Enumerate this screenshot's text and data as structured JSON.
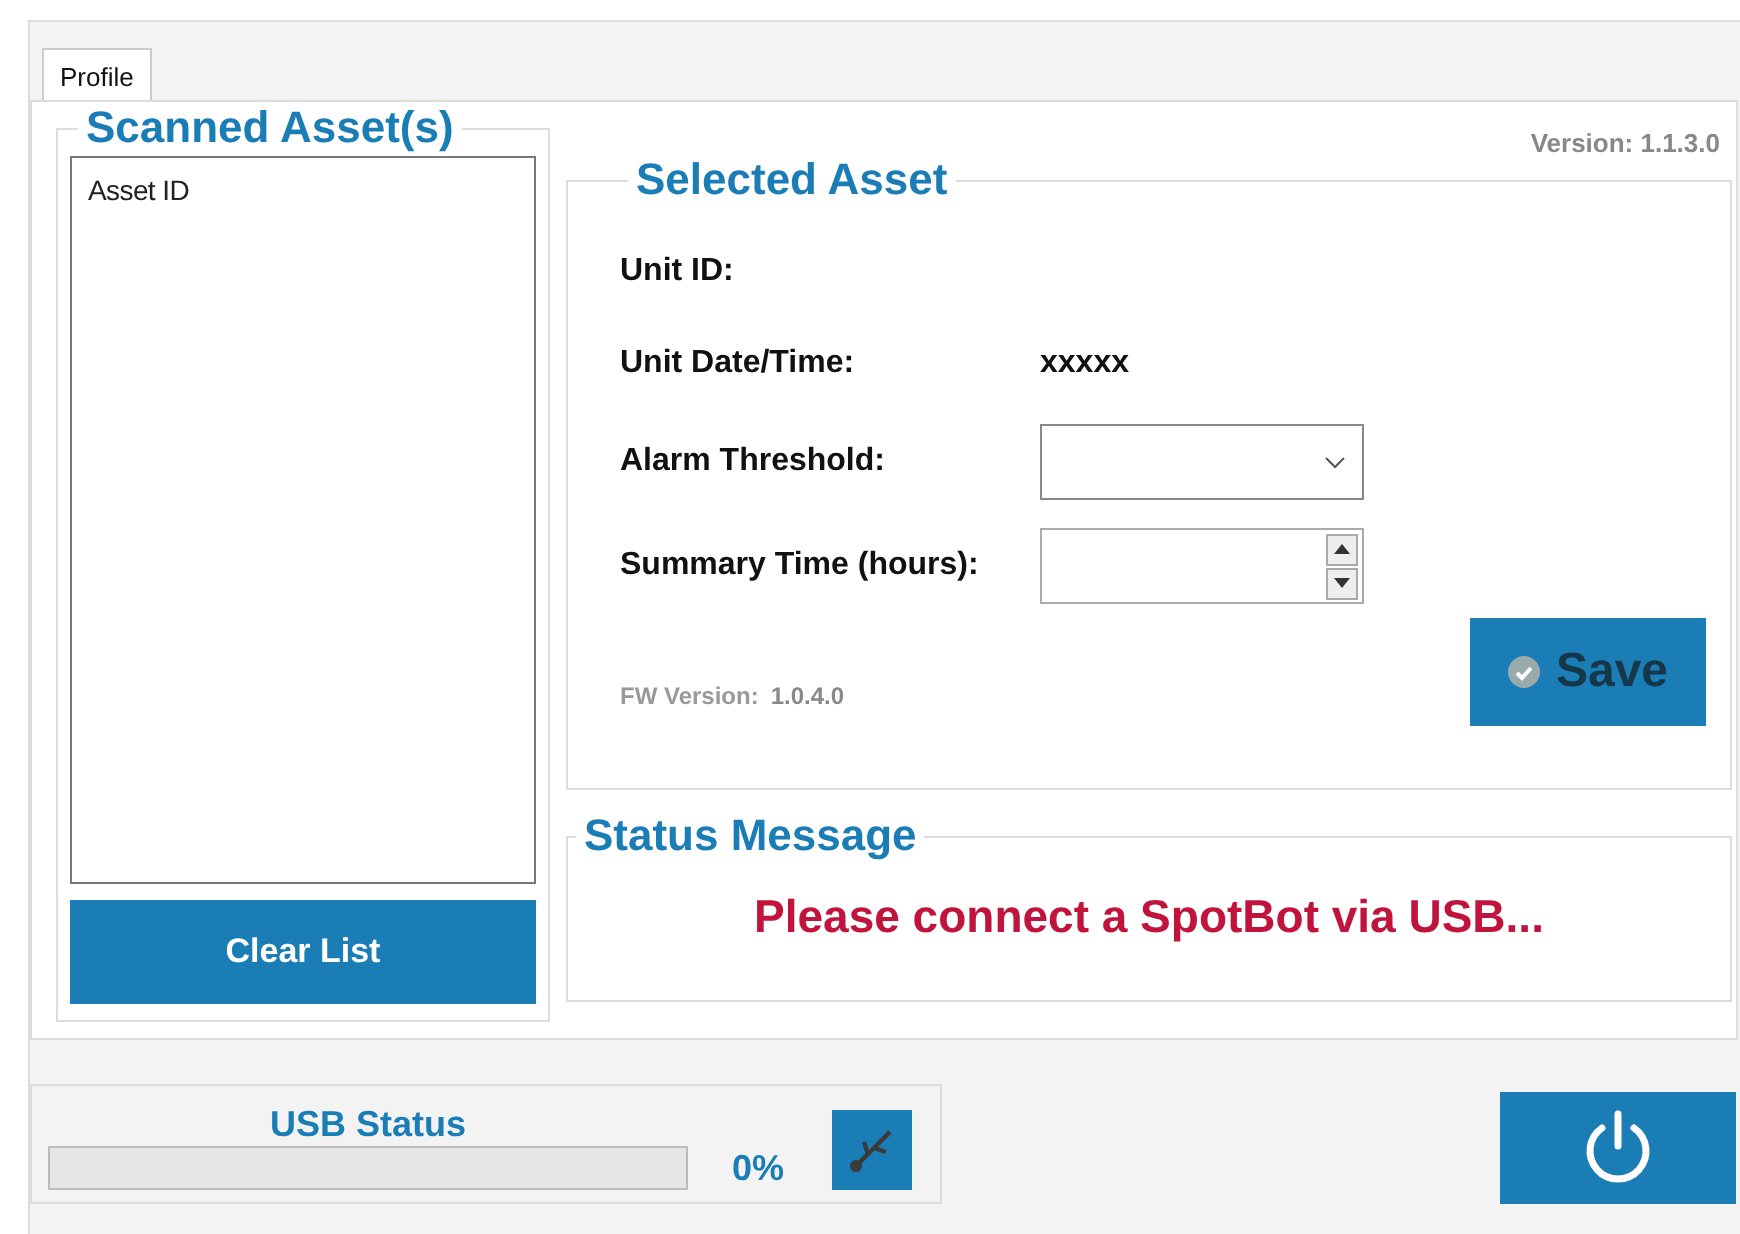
{
  "tabs": [
    {
      "label": "Profile",
      "selected": true
    }
  ],
  "scanned_assets": {
    "title": "Scanned Asset(s)",
    "list_header": "Asset ID",
    "clear_button": "Clear List"
  },
  "version": "Version: 1.1.3.0",
  "selected_asset": {
    "title": "Selected Asset",
    "fields": [
      {
        "kind": "text",
        "label": "Unit ID:"
      },
      {
        "kind": "text",
        "label": "Unit Date/Time:",
        "value": "xxxxx"
      },
      {
        "kind": "dropdown",
        "label": "Alarm Threshold:"
      },
      {
        "kind": "spinner",
        "label": "Summary Time (hours):"
      }
    ],
    "fw_label": "FW Version:",
    "fw_value": "1.0.4.0",
    "save_button": "Save",
    "save_disabled": true
  },
  "status_message": {
    "title": "Status Message",
    "text": "Please connect a SpotBot via USB..."
  },
  "usb_status": {
    "title": "USB Status",
    "level": 0,
    "reading": "0%",
    "connected": false
  }
}
